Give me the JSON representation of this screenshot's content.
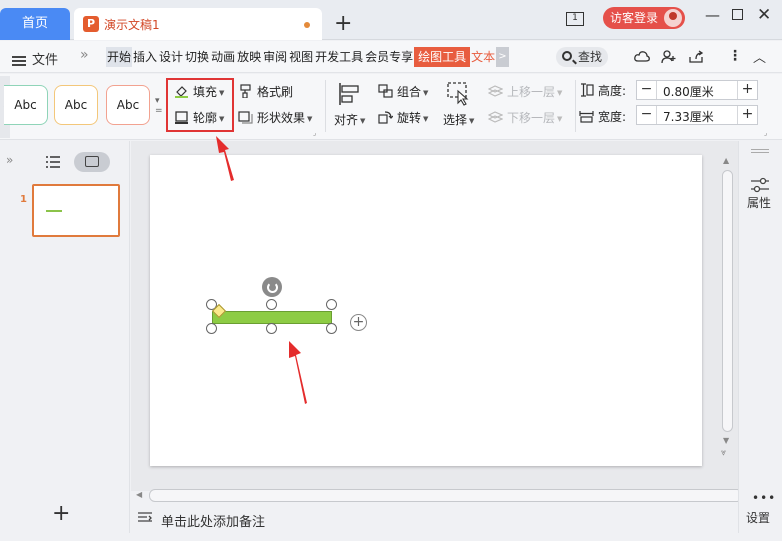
{
  "titlebar": {
    "home_tab": "首页",
    "doc_tab": "演示文稿1",
    "doc_icon_letter": "P",
    "new_tab": "+",
    "window_badge": "1",
    "guest_login": "访客登录"
  },
  "menubar": {
    "file": "文件",
    "nav_arrows": "»",
    "tabs": [
      "开始",
      "插入",
      "设计",
      "切换",
      "动画",
      "放映",
      "审阅",
      "视图",
      "开发工具",
      "会员专享",
      "绘图工具",
      "文本",
      ">"
    ],
    "search": "查找"
  },
  "ribbon": {
    "styles": [
      "Abc",
      "Abc",
      "Abc"
    ],
    "fill": "填充",
    "outline": "轮廓",
    "format_painter": "格式刷",
    "shape_effects": "形状效果",
    "align": "对齐",
    "group": "组合",
    "rotate": "旋转",
    "select": "选择",
    "bring_forward": "上移一层",
    "send_backward": "下移一层",
    "height_label": "高度:",
    "height_value": "0.80厘米",
    "width_label": "宽度:",
    "width_value": "7.33厘米"
  },
  "left_panel": {
    "slide_number": "1",
    "add_slide": "+"
  },
  "right_panel": {
    "properties": "属性",
    "settings": "设置"
  },
  "notes": {
    "placeholder": "单击此处添加备注"
  },
  "colors": {
    "accent_blue": "#4a8af4",
    "accent_orange": "#e85d3f",
    "highlight_red": "#e03535",
    "shape_green": "#8dcc44"
  }
}
